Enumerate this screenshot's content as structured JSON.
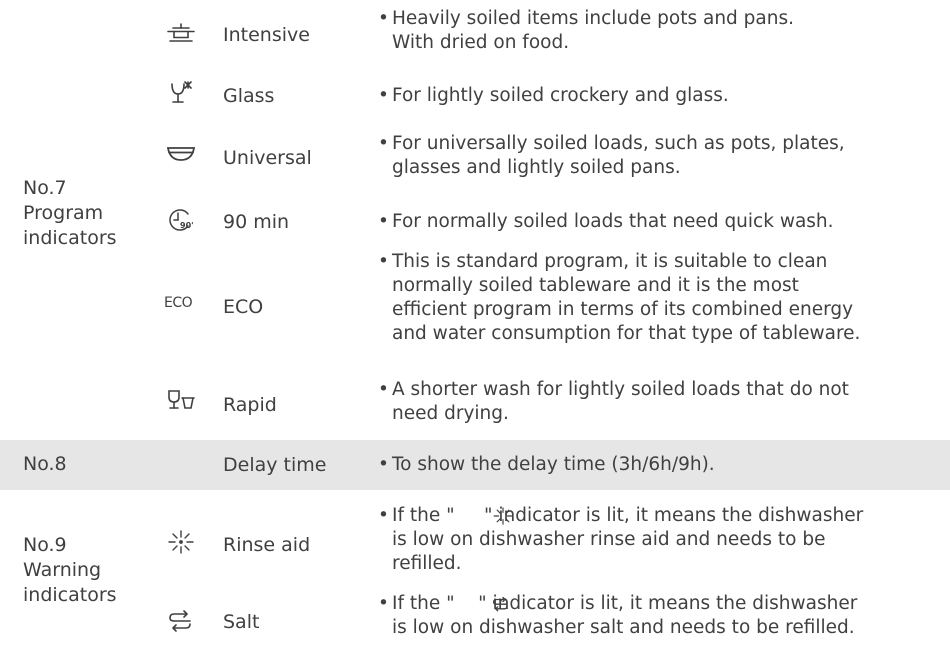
{
  "groups": {
    "no7": "No.7\nProgram\nindicators",
    "no8": "No.8",
    "no9": "No.9\nWarning\nindicators"
  },
  "bullet": "•",
  "rows": [
    {
      "name": "Intensive",
      "icon": "pot-icon",
      "desc": "Heavily soiled items include pots and pans.\nWith dried on food."
    },
    {
      "name": "Glass",
      "icon": "wine-glass-icon",
      "desc": "For lightly soiled crockery and glass."
    },
    {
      "name": "Universal",
      "icon": "bowl-icon",
      "desc": "For universally soiled loads, such as pots, plates,\nglasses and lightly soiled pans."
    },
    {
      "name": "90 min",
      "icon": "timer-90-icon",
      "desc": "For normally soiled loads that need quick wash."
    },
    {
      "name": "ECO",
      "icon": "eco-icon",
      "icon_text": "ECO",
      "desc": "This is standard program, it is suitable to clean\nnormally soiled tableware and it is the most\nefficient program in terms of its combined energy\nand water consumption for that type of tableware."
    },
    {
      "name": "Rapid",
      "icon": "glass-cup-icon",
      "desc": "A shorter wash for lightly soiled loads that do not\nneed drying."
    },
    {
      "name": "Delay time",
      "desc": "To show the delay time (3h/6h/9h)."
    },
    {
      "name": "Rinse aid",
      "icon": "sparkle-icon",
      "desc": "If the \"     \" indicator is lit, it means the dishwasher\nis low on dishwasher rinse aid and needs to be\nrefilled."
    },
    {
      "name": "Salt",
      "icon": "salt-icon",
      "desc": "If the \"    \" indicator is lit, it means the dishwasher\nis low on dishwasher salt and needs to be refilled."
    }
  ]
}
